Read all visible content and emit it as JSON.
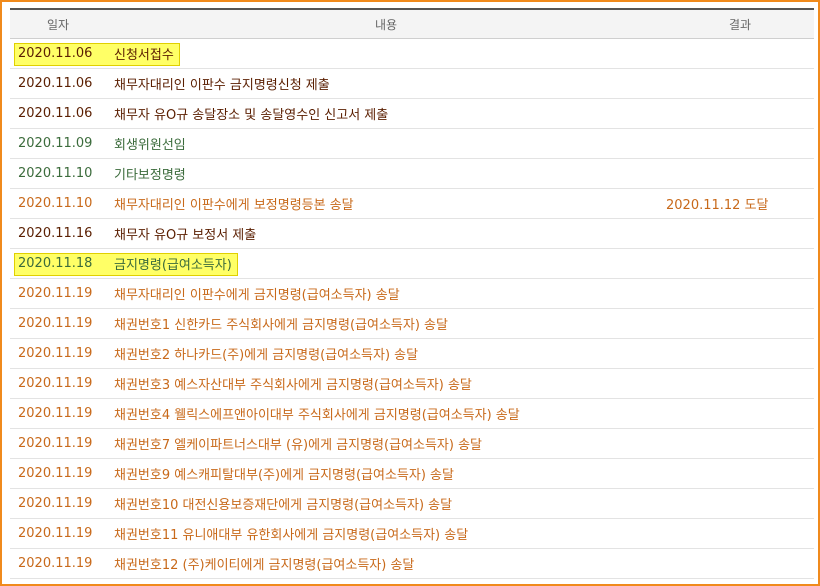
{
  "header": {
    "date": "일자",
    "content": "내용",
    "result": "결과"
  },
  "rows": [
    {
      "date": "2020.11.06",
      "content": "신청서접수",
      "result": "",
      "color": "dark",
      "highlight": true
    },
    {
      "date": "2020.11.06",
      "content": "채무자대리인 이판수 금지명령신청 제출",
      "result": "",
      "color": "dark",
      "highlight": false
    },
    {
      "date": "2020.11.06",
      "content": "채무자 유O규 송달장소 및 송달영수인 신고서 제출",
      "result": "",
      "color": "dark",
      "highlight": false
    },
    {
      "date": "2020.11.09",
      "content": "회생위원선임",
      "result": "",
      "color": "green",
      "highlight": false
    },
    {
      "date": "2020.11.10",
      "content": "기타보정명령",
      "result": "",
      "color": "green",
      "highlight": false
    },
    {
      "date": "2020.11.10",
      "content": "채무자대리인 이판수에게 보정명령등본 송달",
      "result": "2020.11.12 도달",
      "color": "orange",
      "highlight": false
    },
    {
      "date": "2020.11.16",
      "content": "채무자 유O규 보정서 제출",
      "result": "",
      "color": "dark",
      "highlight": false
    },
    {
      "date": "2020.11.18",
      "content": "금지명령(급여소득자)",
      "result": "",
      "color": "green",
      "highlight": true
    },
    {
      "date": "2020.11.19",
      "content": "채무자대리인 이판수에게 금지명령(급여소득자) 송달",
      "result": "",
      "color": "orange",
      "highlight": false
    },
    {
      "date": "2020.11.19",
      "content": "채권번호1 신한카드 주식회사에게 금지명령(급여소득자) 송달",
      "result": "",
      "color": "orange",
      "highlight": false
    },
    {
      "date": "2020.11.19",
      "content": "채권번호2 하나카드(주)에게 금지명령(급여소득자) 송달",
      "result": "",
      "color": "orange",
      "highlight": false
    },
    {
      "date": "2020.11.19",
      "content": "채권번호3 예스자산대부 주식회사에게 금지명령(급여소득자) 송달",
      "result": "",
      "color": "orange",
      "highlight": false
    },
    {
      "date": "2020.11.19",
      "content": "채권번호4 웰릭스에프앤아이대부 주식회사에게 금지명령(급여소득자) 송달",
      "result": "",
      "color": "orange",
      "highlight": false
    },
    {
      "date": "2020.11.19",
      "content": "채권번호7 엘케이파트너스대부 (유)에게 금지명령(급여소득자) 송달",
      "result": "",
      "color": "orange",
      "highlight": false
    },
    {
      "date": "2020.11.19",
      "content": "채권번호9 예스캐피탈대부(주)에게 금지명령(급여소득자) 송달",
      "result": "",
      "color": "orange",
      "highlight": false
    },
    {
      "date": "2020.11.19",
      "content": "채권번호10 대전신용보증재단에게 금지명령(급여소득자) 송달",
      "result": "",
      "color": "orange",
      "highlight": false
    },
    {
      "date": "2020.11.19",
      "content": "채권번호11 유니애대부 유한회사에게 금지명령(급여소득자) 송달",
      "result": "",
      "color": "orange",
      "highlight": false
    },
    {
      "date": "2020.11.19",
      "content": "채권번호12 (주)케이티에게 금지명령(급여소득자) 송달",
      "result": "",
      "color": "orange",
      "highlight": false
    }
  ],
  "colors": {
    "border": "#f08a1c",
    "highlight": "#ffff66",
    "dark": "#5a1e00",
    "green": "#3b6b3b",
    "orange": "#c8691a"
  }
}
